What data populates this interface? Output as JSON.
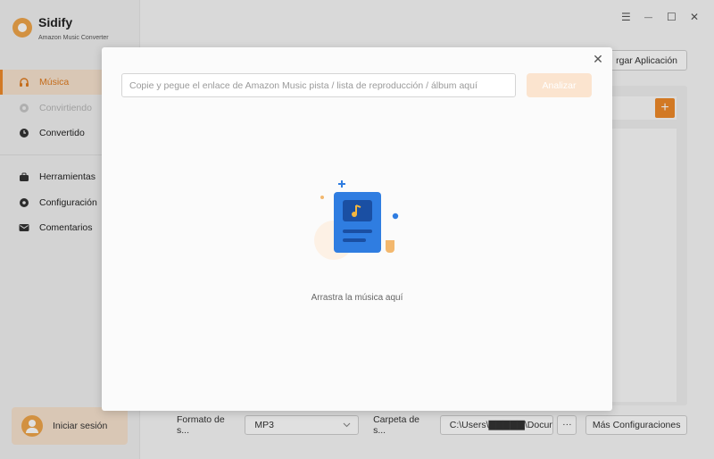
{
  "app": {
    "name": "Sidify",
    "subtitle": "Amazon Music Converter"
  },
  "sidebar": {
    "items": [
      {
        "label": "Música",
        "icon": "headphones-icon",
        "state": "active"
      },
      {
        "label": "Convirtiendo",
        "icon": "converting-icon",
        "state": "disabled"
      },
      {
        "label": "Convertido",
        "icon": "clock-icon",
        "state": "normal"
      },
      {
        "label": "Herramientas",
        "icon": "toolbox-icon",
        "state": "normal"
      },
      {
        "label": "Configuración",
        "icon": "gear-icon",
        "state": "normal"
      },
      {
        "label": "Comentarios",
        "icon": "mail-icon",
        "state": "normal"
      }
    ],
    "login_label": "Iniciar sesión"
  },
  "window": {
    "menu_glyph": "☰",
    "minimize_glyph": "—",
    "maximize_glyph": "☐",
    "close_glyph": "✕"
  },
  "header": {
    "download_app_label": "rgar Aplicación"
  },
  "bottom_bar": {
    "format_label": "Formato de s...",
    "format_value": "MP3",
    "folder_label": "Carpeta de s...",
    "folder_value": "C:\\Users\\▇▇▇▇▇\\Docun",
    "dots_label": "···",
    "more_settings_label": "Más Configuraciones"
  },
  "modal": {
    "close_glyph": "✕",
    "url_placeholder": "Copie y pegue el enlace de Amazon Music pista / lista de reproducción / álbum aquí",
    "url_value": "",
    "analyze_label": "Analizar",
    "drop_text": "Arrastra la música aquí"
  },
  "colors": {
    "accent": "#ef8a2a",
    "accent_light": "#f8e3cf",
    "illustration_blue": "#2f7de1"
  }
}
